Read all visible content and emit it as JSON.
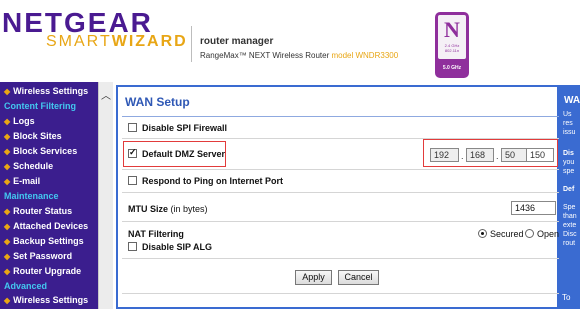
{
  "header": {
    "brand": "NETGEAR",
    "smart": "SMART",
    "wizard": "WIZARD",
    "router_manager": "router manager",
    "router_name": "RangeMax™ NEXT Wireless Router",
    "model": "model WNDR3300",
    "badge_letter": "N",
    "badge_small": "2.4 GHz 802.11n",
    "badge_ghz": "5.0 GHz"
  },
  "sidebar": {
    "entries": [
      {
        "type": "item",
        "label": "Wireless Settings"
      },
      {
        "type": "section",
        "label": "Content Filtering"
      },
      {
        "type": "item",
        "label": "Logs"
      },
      {
        "type": "item",
        "label": "Block Sites"
      },
      {
        "type": "item",
        "label": "Block Services"
      },
      {
        "type": "item",
        "label": "Schedule"
      },
      {
        "type": "item",
        "label": "E-mail"
      },
      {
        "type": "section",
        "label": "Maintenance"
      },
      {
        "type": "item",
        "label": "Router Status"
      },
      {
        "type": "item",
        "label": "Attached Devices"
      },
      {
        "type": "item",
        "label": "Backup Settings"
      },
      {
        "type": "item",
        "label": "Set Password"
      },
      {
        "type": "item",
        "label": "Router Upgrade"
      },
      {
        "type": "section",
        "label": "Advanced"
      },
      {
        "type": "item",
        "label": "Wireless Settings"
      }
    ],
    "scroll_up_icon": "chevron-up-icon"
  },
  "main": {
    "title": "WAN Setup",
    "disable_spi": {
      "label": "Disable SPI Firewall",
      "checked": false
    },
    "default_dmz": {
      "label": "Default DMZ Server",
      "checked": true
    },
    "dmz_ip": [
      "192",
      "168",
      "50",
      "150"
    ],
    "respond_ping": {
      "label": "Respond to Ping on Internet Port",
      "checked": false
    },
    "mtu_label": "MTU Size",
    "mtu_unit": "(in bytes)",
    "mtu_value": "1436",
    "nat_label": "NAT Filtering",
    "nat_options": [
      {
        "label": "Secured",
        "selected": true
      },
      {
        "label": "Open",
        "selected": false
      }
    ],
    "disable_sip": {
      "label": "Disable SIP ALG",
      "checked": false
    },
    "apply_label": "Apply",
    "cancel_label": "Cancel"
  },
  "help": {
    "title": "WA",
    "lines": [
      "Us",
      "res",
      "issu"
    ],
    "subhead_1": "Dis",
    "lines_2": [
      "you",
      "spe"
    ],
    "subhead_2": "Def",
    "lines_3": [
      "Spe",
      "than",
      "exte",
      "Disc",
      "rout"
    ],
    "bottom_link": "To"
  },
  "colors": {
    "sidebar_bg": "#3b1e8e",
    "section_text": "#43c8f0",
    "bullet": "#e8a615",
    "panel_border": "#3a6bd1",
    "title_blue": "#2f58b5",
    "highlight_red": "#e23b3b",
    "brand_purple": "#4a1a91",
    "brand_gold": "#e8a615"
  }
}
